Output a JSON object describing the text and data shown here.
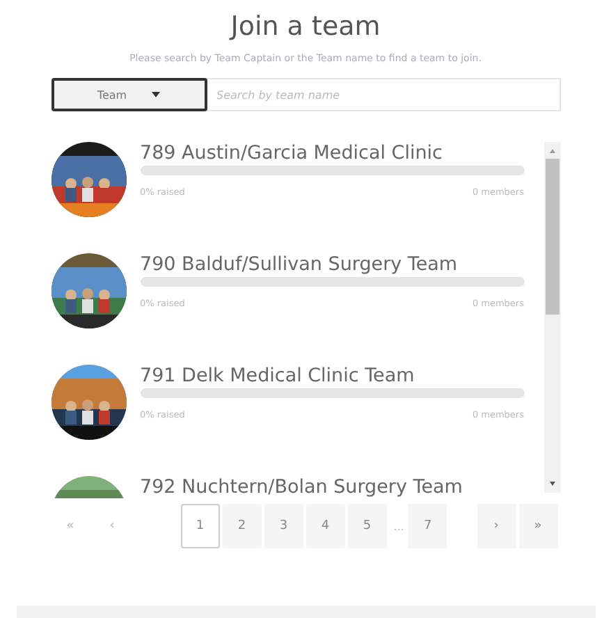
{
  "title": "Join a team",
  "subtitle": "Please search by Team Captain or the Team name to find a team to join.",
  "search": {
    "filter": "Team",
    "placeholder": "Search by team name"
  },
  "teams": [
    {
      "name": "789 Austin/Garcia Medical Clinic",
      "level": 0,
      "raised": "0% raised",
      "members": "0 members"
    },
    {
      "name": "790 Balduf/Sullivan Surgery Team",
      "level": 0,
      "raised": "0% raised",
      "members": "0 members"
    },
    {
      "name": "791 Delk Medical Clinic Team",
      "level": 0,
      "raised": "0% raised",
      "members": "0 members"
    },
    {
      "name": "792 Nuchtern/Bolan Surgery Team"
    }
  ],
  "pagination": {
    "first": {
      "label": "«",
      "disabled": true
    },
    "prev": {
      "label": "‹",
      "disabled": true
    },
    "pages": [
      {
        "kind": "page",
        "label": "1",
        "selected": true
      },
      {
        "kind": "page",
        "label": "2",
        "selected": false
      },
      {
        "kind": "page",
        "label": "3",
        "selected": false
      },
      {
        "kind": "page",
        "label": "4",
        "selected": false
      },
      {
        "kind": "page",
        "label": "5",
        "selected": false
      },
      {
        "kind": "ellipsis",
        "label": "..."
      },
      {
        "kind": "page",
        "label": "7",
        "selected": false
      }
    ],
    "next": {
      "label": "›",
      "disabled": false
    },
    "last": {
      "label": "»",
      "disabled": false
    }
  }
}
